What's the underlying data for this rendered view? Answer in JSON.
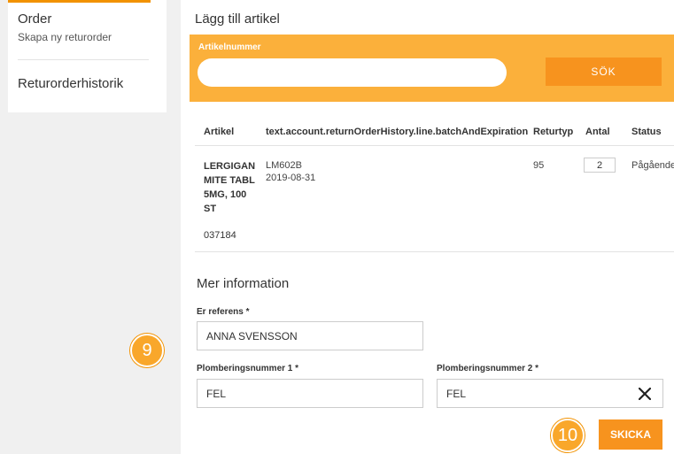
{
  "sidebar": {
    "order_title": "Order",
    "order_sub": "Skapa ny returorder",
    "history_link": "Returorderhistorik"
  },
  "add_article": {
    "title": "Lägg till artikel",
    "field_label": "Artikelnummer",
    "field_value": "",
    "search_button": "SÖK"
  },
  "table": {
    "headers": [
      "Artikel",
      "text.account.returnOrderHistory.line.batchAndExpiration",
      "Returtyp",
      "Antal",
      "Status"
    ],
    "row": {
      "article_name": "LERGIGAN MITE TABL 5MG, 100 ST",
      "article_code": "037184",
      "batch": "LM602B",
      "expiration": "2019-08-31",
      "return_type": "95",
      "quantity": "2",
      "status": "Pågående"
    }
  },
  "more_info": {
    "title": "Mer information",
    "ref_label": "Er referens *",
    "ref_value": "ANNA SVENSSON",
    "seal1_label": "Plomberingsnummer 1 *",
    "seal1_value": "FEL",
    "seal2_label": "Plomberingsnummer 2 *",
    "seal2_value": "FEL",
    "submit_button": "SKICKA"
  },
  "steps": {
    "step9": "9",
    "step10": "10"
  },
  "colors": {
    "accent": "#f7931e",
    "band": "#fbb03b",
    "step": "#f9a72b"
  },
  "icons": {
    "clear": "close-icon"
  }
}
